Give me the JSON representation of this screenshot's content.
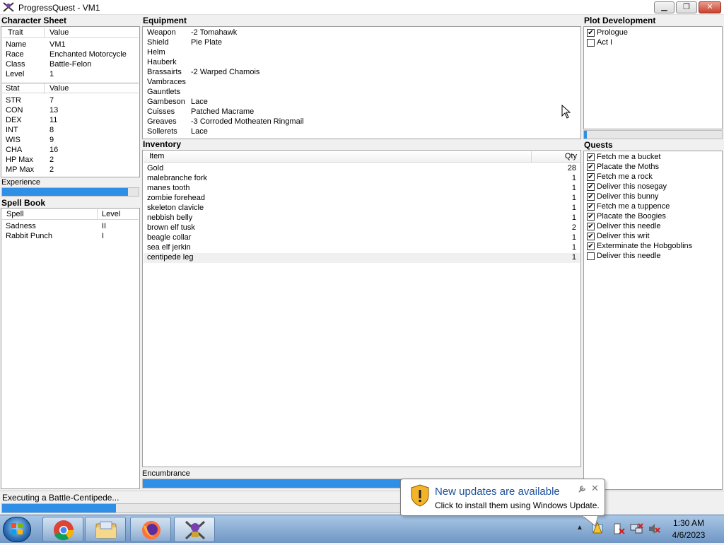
{
  "window": {
    "title": "ProgressQuest - VM1"
  },
  "character_sheet": {
    "title": "Character Sheet",
    "trait_header": [
      "Trait",
      "Value"
    ],
    "traits": [
      {
        "name": "Name",
        "value": "VM1"
      },
      {
        "name": "Race",
        "value": "Enchanted Motorcycle"
      },
      {
        "name": "Class",
        "value": "Battle-Felon"
      },
      {
        "name": "Level",
        "value": "1"
      }
    ],
    "stat_header": [
      "Stat",
      "Value"
    ],
    "stats": [
      {
        "name": "STR",
        "value": "7"
      },
      {
        "name": "CON",
        "value": "13"
      },
      {
        "name": "DEX",
        "value": "11"
      },
      {
        "name": "INT",
        "value": "8"
      },
      {
        "name": "WIS",
        "value": "9"
      },
      {
        "name": "CHA",
        "value": "16"
      },
      {
        "name": "HP Max",
        "value": "2"
      },
      {
        "name": "MP Max",
        "value": "2"
      }
    ],
    "experience_label": "Experience",
    "experience_progress": 0.92
  },
  "spell_book": {
    "title": "Spell Book",
    "header": [
      "Spell",
      "Level"
    ],
    "spells": [
      {
        "name": "Sadness",
        "level": "II"
      },
      {
        "name": "Rabbit Punch",
        "level": "I"
      }
    ]
  },
  "equipment": {
    "title": "Equipment",
    "items": [
      {
        "slot": "Weapon",
        "item": "-2 Tomahawk"
      },
      {
        "slot": "Shield",
        "item": "Pie Plate"
      },
      {
        "slot": "Helm",
        "item": ""
      },
      {
        "slot": "Hauberk",
        "item": ""
      },
      {
        "slot": "Brassairts",
        "item": "-2 Warped Chamois"
      },
      {
        "slot": "Vambraces",
        "item": ""
      },
      {
        "slot": "Gauntlets",
        "item": ""
      },
      {
        "slot": "Gambeson",
        "item": "Lace"
      },
      {
        "slot": "Cuisses",
        "item": "Patched Macrame"
      },
      {
        "slot": "Greaves",
        "item": "-3 Corroded Motheaten Ringmail"
      },
      {
        "slot": "Sollerets",
        "item": "Lace"
      }
    ]
  },
  "inventory": {
    "title": "Inventory",
    "header": [
      "Item",
      "Qty"
    ],
    "items": [
      {
        "name": "Gold",
        "qty": "28"
      },
      {
        "name": "malebranche fork",
        "qty": "1"
      },
      {
        "name": "manes tooth",
        "qty": "1"
      },
      {
        "name": "zombie forehead",
        "qty": "1"
      },
      {
        "name": "skeleton clavicle",
        "qty": "1"
      },
      {
        "name": "nebbish belly",
        "qty": "1"
      },
      {
        "name": "brown elf tusk",
        "qty": "2"
      },
      {
        "name": "beagle collar",
        "qty": "1"
      },
      {
        "name": "sea elf jerkin",
        "qty": "1"
      },
      {
        "name": "centipede leg",
        "qty": "1"
      }
    ],
    "encumbrance_label": "Encumbrance",
    "encumbrance_progress": 0.97
  },
  "plot": {
    "title": "Plot Development",
    "acts": [
      {
        "label": "Prologue",
        "checked": true
      },
      {
        "label": "Act I",
        "checked": false
      }
    ],
    "progress": 0.02
  },
  "quests": {
    "title": "Quests",
    "items": [
      {
        "label": "Fetch me a bucket",
        "checked": true
      },
      {
        "label": "Placate the Moths",
        "checked": true
      },
      {
        "label": "Fetch me a rock",
        "checked": true
      },
      {
        "label": "Deliver this nosegay",
        "checked": true
      },
      {
        "label": "Deliver this bunny",
        "checked": true
      },
      {
        "label": "Fetch me a tuppence",
        "checked": true
      },
      {
        "label": "Placate the Boogies",
        "checked": true
      },
      {
        "label": "Deliver this needle",
        "checked": true
      },
      {
        "label": "Deliver this writ",
        "checked": true
      },
      {
        "label": "Exterminate the Hobgoblins",
        "checked": true
      },
      {
        "label": "Deliver this needle",
        "checked": false
      }
    ]
  },
  "status": {
    "text": "Executing a Battle-Centipede...",
    "progress": 0.27
  },
  "notification": {
    "title": "New updates are available",
    "body": "Click to install them using Windows Update."
  },
  "taskbar": {
    "time": "1:30 AM",
    "date": "4/6/2023",
    "pinned": [
      "chrome-icon",
      "explorer-icon",
      "firefox-icon",
      "progressquest-icon"
    ]
  },
  "colors": {
    "progress_fill": "#2f8ee6",
    "taskbar": "#8fb1d9",
    "notification_title": "#1c4f9c"
  }
}
